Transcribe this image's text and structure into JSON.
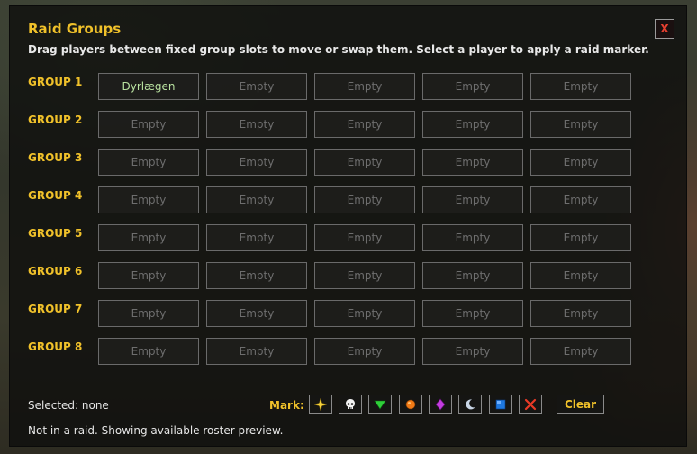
{
  "window": {
    "title": "Raid Groups",
    "close_label": "X",
    "subtitle": "Drag players between fixed group slots to move or swap them. Select a player to apply a raid marker."
  },
  "groups": [
    {
      "label": "GROUP 1",
      "slots": [
        "Dyrlægen",
        "Empty",
        "Empty",
        "Empty",
        "Empty"
      ]
    },
    {
      "label": "GROUP 2",
      "slots": [
        "Empty",
        "Empty",
        "Empty",
        "Empty",
        "Empty"
      ]
    },
    {
      "label": "GROUP 3",
      "slots": [
        "Empty",
        "Empty",
        "Empty",
        "Empty",
        "Empty"
      ]
    },
    {
      "label": "GROUP 4",
      "slots": [
        "Empty",
        "Empty",
        "Empty",
        "Empty",
        "Empty"
      ]
    },
    {
      "label": "GROUP 5",
      "slots": [
        "Empty",
        "Empty",
        "Empty",
        "Empty",
        "Empty"
      ]
    },
    {
      "label": "GROUP 6",
      "slots": [
        "Empty",
        "Empty",
        "Empty",
        "Empty",
        "Empty"
      ]
    },
    {
      "label": "GROUP 7",
      "slots": [
        "Empty",
        "Empty",
        "Empty",
        "Empty",
        "Empty"
      ]
    },
    {
      "label": "GROUP 8",
      "slots": [
        "Empty",
        "Empty",
        "Empty",
        "Empty",
        "Empty"
      ]
    }
  ],
  "footer": {
    "selected": "Selected: none",
    "mark_label": "Mark:",
    "markers": [
      "star-icon",
      "skull-icon",
      "triangle-icon",
      "circle-icon",
      "diamond-icon",
      "moon-icon",
      "square-icon",
      "cross-icon"
    ],
    "clear_label": "Clear",
    "status": "Not in a raid. Showing available roster preview."
  },
  "colors": {
    "accent": "#f0c12a",
    "filled_slot_text": "#b9e2a0",
    "empty_slot_text": "#6e6e6e",
    "close_x": "#e84030"
  }
}
